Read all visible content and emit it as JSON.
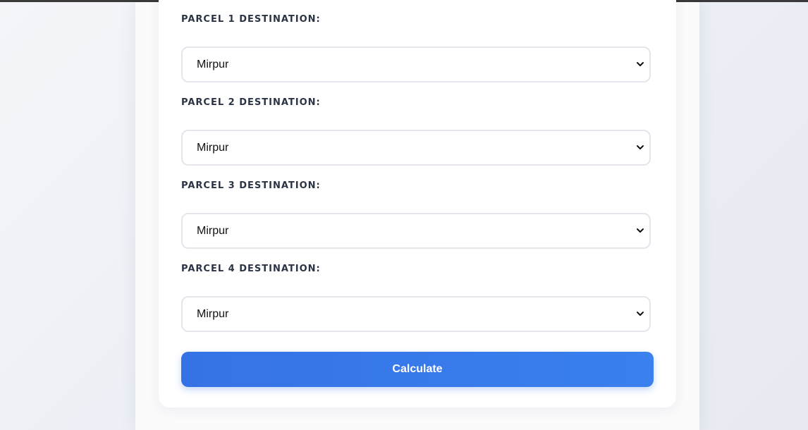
{
  "form": {
    "parcels": [
      {
        "label": "PARCEL 1 DESTINATION:",
        "selected": "Mirpur"
      },
      {
        "label": "PARCEL 2 DESTINATION:",
        "selected": "Mirpur"
      },
      {
        "label": "PARCEL 3 DESTINATION:",
        "selected": "Mirpur"
      },
      {
        "label": "PARCEL 4 DESTINATION:",
        "selected": "Mirpur"
      }
    ],
    "calculate_label": "Calculate"
  },
  "colors": {
    "accent": "#3572e6",
    "label_text": "#2b3445",
    "select_border": "#e3e6ec"
  },
  "icons": {
    "select_chevron": "chevron-down-icon"
  }
}
